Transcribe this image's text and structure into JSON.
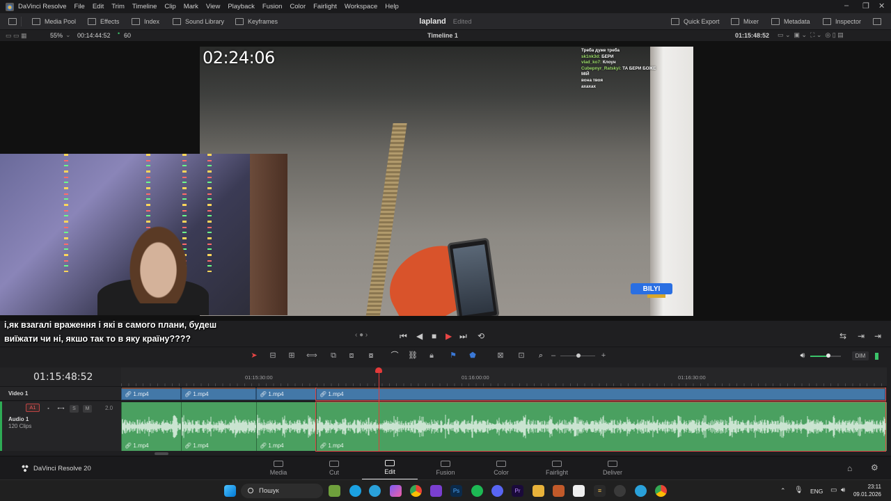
{
  "app": {
    "title": "DaVinci Resolve"
  },
  "menu": [
    "File",
    "Edit",
    "Trim",
    "Timeline",
    "Clip",
    "Mark",
    "View",
    "Playback",
    "Fusion",
    "Color",
    "Fairlight",
    "Workspace",
    "Help"
  ],
  "toolbar": {
    "left": [
      "Media Pool",
      "Effects",
      "Index",
      "Sound Library",
      "Keyframes"
    ],
    "project_name": "lapland",
    "project_status": "Edited",
    "right": [
      "Quick Export",
      "Mixer",
      "Metadata",
      "Inspector"
    ]
  },
  "viewer_strip": {
    "zoom": "55%",
    "source_tc": "00:14:44:52",
    "fps": "60",
    "timeline_name": "Timeline 1",
    "record_tc": "01:15:48:52"
  },
  "video_overlay": {
    "clock": "02:24:06",
    "chat": [
      {
        "user": "",
        "msg": "Треба дуже треба"
      },
      {
        "user": "sk1nk3d:",
        "msg": "БЕРИ"
      },
      {
        "user": "vlad_ko7:",
        "msg": "Клоун"
      },
      {
        "user": "Cubepnyr_Ratskyi:",
        "msg": "ТА БЕРИ БОЖЕ МІЙ"
      },
      {
        "user": "",
        "msg": "вона твоя"
      },
      {
        "user": "",
        "msg": "ахахах"
      }
    ],
    "badge": "BILYI"
  },
  "subtitle": "і,як взагалі враження і які в самого плани, будеш виїжати чи ні, якшо так то в яку країну????",
  "timeline": {
    "timecode": "01:15:48:52",
    "ruler_labels": [
      "01:15:30:00",
      "01:16:00:00",
      "01:16:30:00"
    ],
    "video_track": {
      "name": "Video 1"
    },
    "audio_track": {
      "tag": "A1",
      "name": "Audio 1",
      "count": "120 Clips",
      "level": "2.0",
      "solo": "S",
      "mute": "M"
    },
    "clips": [
      "1.mp4",
      "1.mp4",
      "1.mp4",
      "1.mp4"
    ]
  },
  "volume": {
    "dim": "DIM",
    "level": 0.6
  },
  "pages": [
    "Media",
    "Cut",
    "Edit",
    "Fusion",
    "Color",
    "Fairlight",
    "Deliver"
  ],
  "active_page": "Edit",
  "brand": "DaVinci Resolve 20",
  "taskbar": {
    "search": "Пошук",
    "lang": "ENG",
    "time": "23:11",
    "date": "09.01.2026"
  }
}
